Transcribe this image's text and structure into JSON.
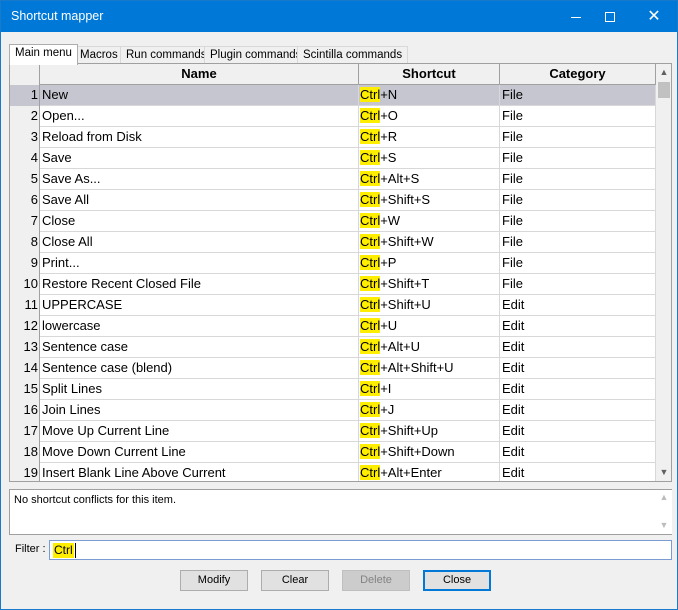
{
  "window": {
    "title": "Shortcut mapper",
    "minimize": "",
    "maximize": "",
    "close": "✕"
  },
  "tabs": [
    "Main menu",
    "Macros",
    "Run commands",
    "Plugin commands",
    "Scintilla commands"
  ],
  "grid": {
    "headers": {
      "name": "Name",
      "shortcut": "Shortcut",
      "category": "Category"
    },
    "rows": [
      {
        "num": "1",
        "name": "New",
        "hl": "Ctrl",
        "rest": "+N",
        "category": "File"
      },
      {
        "num": "2",
        "name": "Open...",
        "hl": "Ctrl",
        "rest": "+O",
        "category": "File"
      },
      {
        "num": "3",
        "name": "Reload from Disk",
        "hl": "Ctrl",
        "rest": "+R",
        "category": "File"
      },
      {
        "num": "4",
        "name": "Save",
        "hl": "Ctrl",
        "rest": "+S",
        "category": "File"
      },
      {
        "num": "5",
        "name": "Save As...",
        "hl": "Ctrl",
        "rest": "+Alt+S",
        "category": "File"
      },
      {
        "num": "6",
        "name": "Save All",
        "hl": "Ctrl",
        "rest": "+Shift+S",
        "category": "File"
      },
      {
        "num": "7",
        "name": "Close",
        "hl": "Ctrl",
        "rest": "+W",
        "category": "File"
      },
      {
        "num": "8",
        "name": "Close All",
        "hl": "Ctrl",
        "rest": "+Shift+W",
        "category": "File"
      },
      {
        "num": "9",
        "name": "Print...",
        "hl": "Ctrl",
        "rest": "+P",
        "category": "File"
      },
      {
        "num": "10",
        "name": "Restore Recent Closed File",
        "hl": "Ctrl",
        "rest": "+Shift+T",
        "category": "File"
      },
      {
        "num": "11",
        "name": "UPPERCASE",
        "hl": "Ctrl",
        "rest": "+Shift+U",
        "category": "Edit"
      },
      {
        "num": "12",
        "name": "lowercase",
        "hl": "Ctrl",
        "rest": "+U",
        "category": "Edit"
      },
      {
        "num": "13",
        "name": "Sentence case",
        "hl": "Ctrl",
        "rest": "+Alt+U",
        "category": "Edit"
      },
      {
        "num": "14",
        "name": "Sentence case (blend)",
        "hl": "Ctrl",
        "rest": "+Alt+Shift+U",
        "category": "Edit"
      },
      {
        "num": "15",
        "name": "Split Lines",
        "hl": "Ctrl",
        "rest": "+I",
        "category": "Edit"
      },
      {
        "num": "16",
        "name": "Join Lines",
        "hl": "Ctrl",
        "rest": "+J",
        "category": "Edit"
      },
      {
        "num": "17",
        "name": "Move Up Current Line",
        "hl": "Ctrl",
        "rest": "+Shift+Up",
        "category": "Edit"
      },
      {
        "num": "18",
        "name": "Move Down Current Line",
        "hl": "Ctrl",
        "rest": "+Shift+Down",
        "category": "Edit"
      },
      {
        "num": "19",
        "name": "Insert Blank Line Above Current",
        "hl": "Ctrl",
        "rest": "+Alt+Enter",
        "category": "Edit"
      }
    ],
    "scroll_up": "▲",
    "scroll_down": "▼"
  },
  "conflicts": {
    "message": "No shortcut conflicts for this item."
  },
  "filter": {
    "label": "Filter :",
    "value": "Ctrl"
  },
  "buttons": {
    "modify": "Modify",
    "clear": "Clear",
    "delete": "Delete",
    "close": "Close"
  },
  "colors": {
    "titlebar": "#0078d7",
    "highlight": "#ffee00",
    "selected_row": "#c6c6d0"
  }
}
